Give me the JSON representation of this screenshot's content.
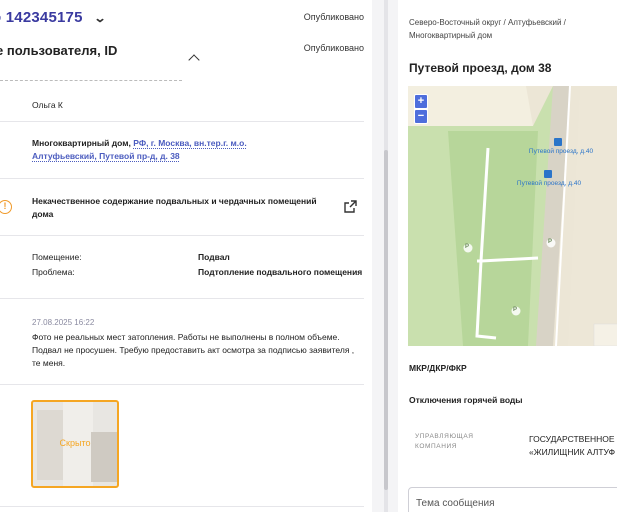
{
  "left": {
    "header": {
      "title": "о 142345175",
      "status": "Опубликовано"
    },
    "subheader": {
      "title": "е пользователя, ID",
      "status": "Опубликовано"
    },
    "user_name": "Ольга К",
    "building": {
      "type": "Многоквартирный дом,",
      "address_line1": "РФ, г. Москва, вн.тер.г. м.о.",
      "address_line2": "Алтуфьевский, Путевой пр-д, д. 38"
    },
    "issue": {
      "icon": "warning-icon",
      "title": "Некачественное содержание подвальных и чердачных помещений дома"
    },
    "details": [
      {
        "label": "Помещение:",
        "value": "Подвал"
      },
      {
        "label": "Проблема:",
        "value": "Подтопление подвального помещения"
      }
    ],
    "comment": {
      "timestamp": "27.08.2025 16:22",
      "text": "Фото не реальных мест затопления. Работы не выполнены в полном объеме. Подвал не просушен. Требую предоставить акт осмотра за подписью заявителя , те меня."
    },
    "attachment": {
      "label": "Скрыто",
      "border_color": "#f5a623"
    }
  },
  "right": {
    "breadcrumb": "Северо-Восточный округ / Алтуфьевский / Многоквартирный дом",
    "address_title": "Путевой проезд, дом 38",
    "map": {
      "zoom_in": "+",
      "zoom_out": "−",
      "stop1": "Путевой проезд, д.40",
      "stop2": "Путевой проезд, д.40",
      "parking1": "P",
      "parking2": "P",
      "parking3": "P"
    },
    "section1": "МКР/ДКР/ФКР",
    "section2": "Отключения горячей воды",
    "company_label_line1": "УПРАВЛЯЮЩАЯ",
    "company_label_line2": "КОМПАНИЯ",
    "company_value_line1": "ГОСУДАРСТВЕННОЕ",
    "company_value_line2": "«ЖИЛИЩНИК АЛТУФ",
    "message_placeholder": "Тема сообщения"
  },
  "colors": {
    "accent": "#3a3aa0",
    "link": "#4b5cbf",
    "warning": "#f09a2a",
    "map_green": "#b7d69a"
  }
}
